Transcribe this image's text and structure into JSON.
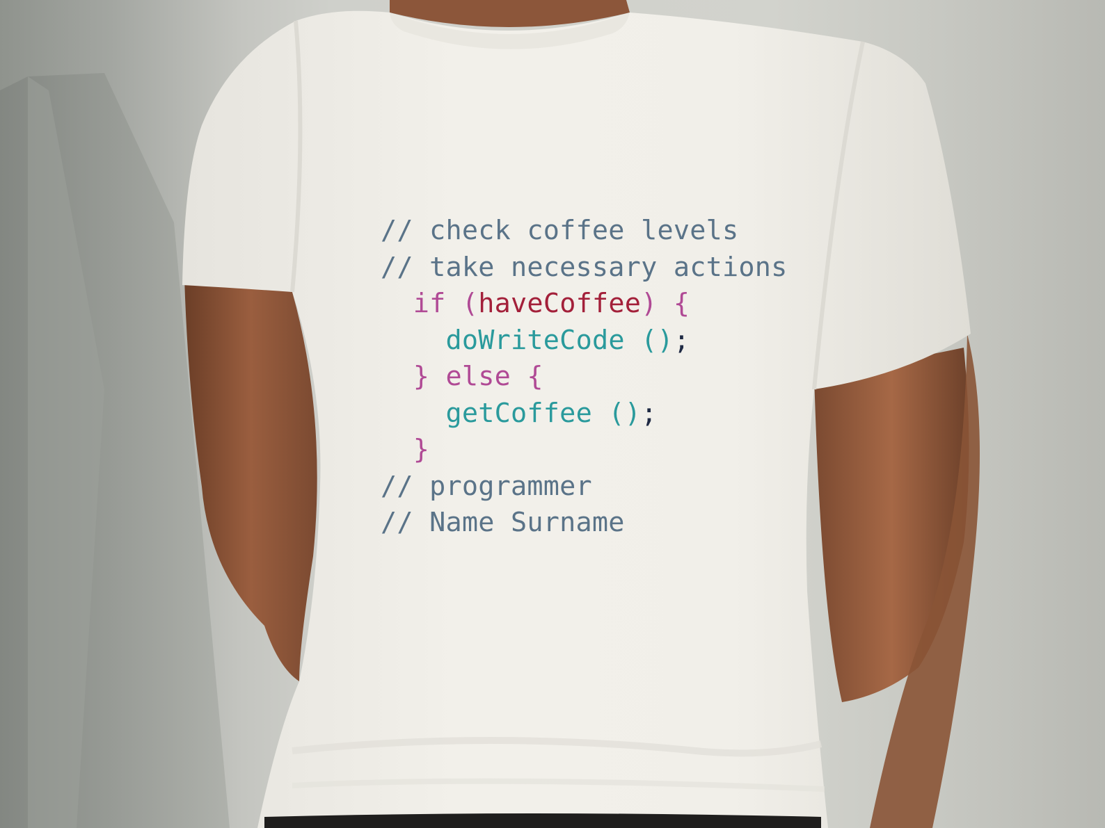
{
  "colors": {
    "comment": "#5a7388",
    "keyword": "#b04a95",
    "variable": "#a3203a",
    "function": "#2a9a9c",
    "punctuation": "#1f2a44",
    "shirt": "#f1efe9",
    "skin": "#9a5e3f",
    "wall": "#cfd0cb"
  },
  "print": {
    "lines": [
      {
        "indent": "",
        "tokens": [
          {
            "t": "// check coffee levels",
            "c": "comment"
          }
        ]
      },
      {
        "indent": "",
        "tokens": [
          {
            "t": "// take necessary actions",
            "c": "comment"
          }
        ]
      },
      {
        "indent": "  ",
        "tokens": [
          {
            "t": "if (",
            "c": "keyword"
          },
          {
            "t": "haveCoffee",
            "c": "variable"
          },
          {
            "t": ") {",
            "c": "keyword"
          }
        ]
      },
      {
        "indent": "    ",
        "tokens": [
          {
            "t": "doWriteCode ()",
            "c": "function"
          },
          {
            "t": ";",
            "c": "punctuation"
          }
        ]
      },
      {
        "indent": "  ",
        "tokens": [
          {
            "t": "} else {",
            "c": "keyword"
          }
        ]
      },
      {
        "indent": "    ",
        "tokens": [
          {
            "t": "getCoffee ()",
            "c": "function"
          },
          {
            "t": ";",
            "c": "punctuation"
          }
        ]
      },
      {
        "indent": "  ",
        "tokens": [
          {
            "t": "}",
            "c": "keyword"
          }
        ]
      },
      {
        "indent": "",
        "tokens": [
          {
            "t": "// programmer",
            "c": "comment"
          }
        ]
      },
      {
        "indent": "",
        "tokens": [
          {
            "t": "// Name Surname",
            "c": "comment"
          }
        ]
      }
    ]
  }
}
